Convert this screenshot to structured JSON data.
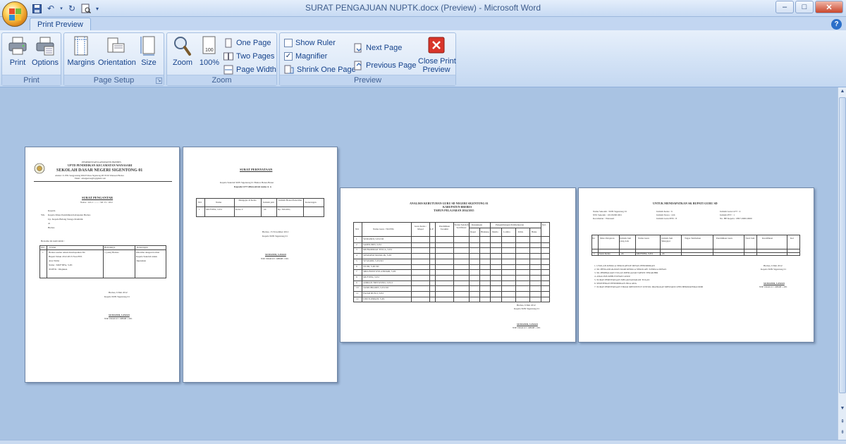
{
  "window": {
    "title": "SURAT PENGAJUAN NUPTK.docx (Preview) - Microsoft Word",
    "controls": {
      "minimize": "–",
      "maximize": "□",
      "close": "✕"
    }
  },
  "tabs": [
    {
      "label": "Print Preview",
      "active": true
    }
  ],
  "help": "?",
  "ribbon": {
    "print_group": {
      "label": "Print",
      "print": "Print",
      "options": "Options"
    },
    "page_setup_group": {
      "label": "Page Setup",
      "margins": "Margins",
      "orientation": "Orientation",
      "size": "Size"
    },
    "zoom_group": {
      "label": "Zoom",
      "zoom": "Zoom",
      "hundred": "100%",
      "one_page": "One Page",
      "two_pages": "Two Pages",
      "page_width": "Page Width"
    },
    "preview_group": {
      "label": "Preview",
      "show_ruler": "Show Ruler",
      "show_ruler_checked": false,
      "magnifier": "Magnifier",
      "magnifier_checked": true,
      "shrink_one_page": "Shrink One Page",
      "next_page": "Next Page",
      "previous_page": "Previous Page",
      "close_line1": "Close Print",
      "close_line2": "Preview"
    }
  },
  "pages": {
    "p1": {
      "l1": "PEMERINTAH KABUPATEN BREBES",
      "l2": "UPTD PENDIDIKAN KECAMATAN WANASARI",
      "l3": "SEKOLAH DASAR NEGERI SIGENTONG 01",
      "l4": "Alamat: Jl. PTK Sengpontang KM.03 Desa Sigentong RT 05/02 Wanasari Brebes",
      "l5": "Email : sdnsigentong01@gmail.com",
      "title": "SURAT PENGANTAR",
      "nomor": "Nomor : 421.2 / ........ / SD / IV / 2012",
      "kepada": "Kepada",
      "yth": "Yth.",
      "yth2": "Kepala Dinas Pendidikan Kabupaten Brebes",
      "up": "Up. Kepala Bidang Tenaga Pendidik",
      "di": "di",
      "brebes": "Brebes",
      "intro": "Bersama ini kami kirim :",
      "h_no": "NO",
      "h_uraian": "Uraian",
      "h_banyaknya": "Banyaknya",
      "h_ket": "Keterangan",
      "r1": "1",
      "r1a": "Berkas usulan untuk mendapatkan SK",
      "r1b": "Bupati Tahun 2012/2013 Non PNS",
      "r1c": "Atas Nama",
      "r1d": "Nama        : MUFTIFA, S.Pd",
      "r1e": "NUPTK : Diajukan",
      "qty": "1 (satu) Berkas",
      "ket1": "Diterima dengan hormat",
      "ket2": "Kepala Sekolah untuk",
      "ket3": "digunakan",
      "place": "Brebes, 6 Mei 2012",
      "sign": "Kepala SDN Sigentong 01",
      "name": "SUMANDI, S.Pd.SD",
      "nip": "NIP. 19640115 198608 1 001"
    },
    "p2": {
      "title": "SURAT PERNYATAAN",
      "l1": "Kepala Sekolah SDN Sigentong 01 Bahwa Benar-Benar",
      "l2": "Kepada GTT dibawah ini nama A. n",
      "h1": "NO",
      "h2": "Nama",
      "h3": "Mengajar di Kelas",
      "h4": "Jumlah jam",
      "h5": "Jumlah Honor/Penerima",
      "h6": "Keterangan",
      "r1": "1",
      "r2": "MUFTIFA, S.Pd",
      "r3": "Kelas V",
      "r4": "24",
      "r5": "Rp. 300.000,-",
      "place": "Brebes, 15 November 2012",
      "sign": "Kepala SDN Sigentong 01",
      "name": "SUMANDI, S.Pd.SD",
      "nip": "NIP. 19640115 198608 1 001"
    },
    "p3": {
      "l1": "ANALISIS KEBUTUHAN GURU SD NEGERI SIGENTONG 01",
      "l2": "KABUPATEN BREBES",
      "l3": "TAHUN PELAJARAN 2014/2015",
      "h_no": "NO",
      "h_nama": "Nama Guru / NUPTK",
      "h_kelas": "Guru Kelas / Mapel",
      "h_lp": "L/P",
      "h_pend": "Pendidikan Terakhir",
      "h_status": "Status Sekolah Sertifikasi",
      "h_kunjungan": "Kunjungan",
      "h_pengembangan": "Pengembangan Pembelajaran",
      "h_ket": "Ket.",
      "s1": "Rapat",
      "s2": "Binkung",
      "s3": "Media",
      "s4": "Lomba",
      "s5": "KKG",
      "s6": "Buku",
      "names": [
        "SUMANDI, S.Pd.SD",
        "SAMSUDIN, S.Pd",
        "MUHAMMAD TITO A, S.Pd",
        "SOWARSO MATALIK, S.Pd",
        "SUWARDI, S.Pd.SD",
        "WUDI, S.Pd.SD",
        "SRIA BUDI WULANDARI, S.Pd",
        "MUFTIFA, S.Pd",
        "ADRIAN TRISWONO, S.Pd.I",
        "TASRUBIADIN, S.Pd.SD",
        "FAJAR RUSLI, S.Pd",
        "UMI SUPRIATI, S.Pd"
      ],
      "place": "Brebes, 6 Mei 2012",
      "sign": "Kepala SDN Sigentong 01",
      "name": "SUMANDI, S.Pd.SD",
      "nip": "NIP. 19640115 198608 1 001"
    },
    "p4": {
      "title": "UNTUK MENDAPATKAN SK BUPATI GURU SD",
      "a1": "Nama Sekolah : SDN Sigentong 01",
      "a2": "NSS Sekolah : 101032901001",
      "a3": "Kecamatan : Wanasari",
      "b1": "Jumlah Kelas : 6",
      "b2": "Jumlah Siswa : 224",
      "b3": "Jumlah Guru PNS : 8",
      "c1": "Jumlah Guru GTT : 4",
      "c2": "Jumlah PTT : 1",
      "c3": "No. HP Kepala : 0857-0000-0000",
      "h1": "No",
      "h2": "Mata Pelajaran",
      "h3": "Jumlah Jam yang Ada",
      "h4": "Nama Guru",
      "h5": "Jumlah Jam Mengajar",
      "h6": "Tugas Tambahan",
      "h7": "Pendidikan Guru",
      "h8": "Total Jam",
      "h9": "Kualifikasi",
      "h10": "Ket",
      "r_no": "1",
      "r_mapel": "Guru Kelas",
      "r_jam": "24",
      "r_nama": "MUFTIFA, S.Pd",
      "r_j": "24",
      "lst1": "1. USULAN KEPALA SEKOLAH KE DINAS PENDIDIKAN",
      "lst2": "2. SK PENGANGKATAN DARI KEPALA SEKOLAH / KEPALA DINAS",
      "lst3": "3. SK PEMBAGIAN TUGAS MENGAJAR TAHUN TERAKHIR",
      "lst4": "4. ANALISIS KEBUTUHAN GURU",
      "lst5": "5. SURAT PERNYATAAN MELAKSANAKAN TUGAS",
      "lst6": "6. SERTIFIKAT PENDIDIKAN JIKA ADA",
      "lst7": "7. SURAT PERNYATAAN TIDAK MENUNTUT UNTUK DIANGKAT MENJADI CPNS BERMATERAI 6000",
      "place": "Brebes, 6 Mei 2012",
      "sign": "Kepala SDN Sigentong 01",
      "name": "SUMANDI, S.Pd.SD",
      "nip": "NIP. 19640115 198608 1 001"
    }
  },
  "colors": {
    "accent": "#15428b",
    "workspace": "#a9c3e3",
    "close_red": "#d9352a"
  }
}
